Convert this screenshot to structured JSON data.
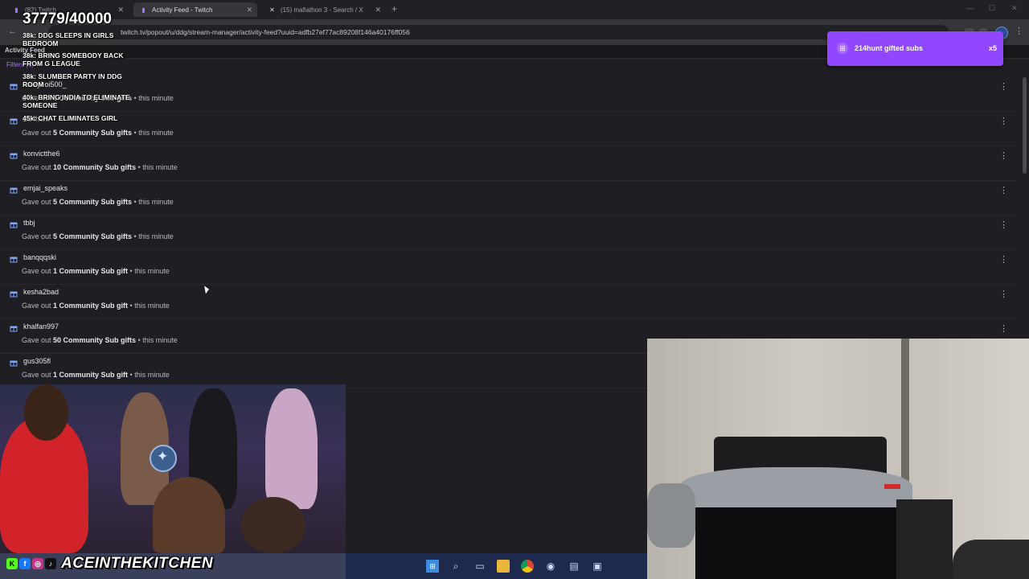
{
  "browser": {
    "tabs": [
      {
        "label": "(82) Twitch",
        "active": false
      },
      {
        "label": "Activity Feed - Twitch",
        "active": true
      },
      {
        "label": "(15) mafiathon 3 - Search / X",
        "active": false
      }
    ],
    "new_tab_label": "+",
    "url": "twitch.tv/popout/u/ddg/stream-manager/activity-feed?uuid=adfb27ef77ac89208f146a40176ff056"
  },
  "page": {
    "title": "Activity Feed",
    "filters_label": "Filters (1)"
  },
  "overlay": {
    "goal": "37779/40000",
    "milestones": [
      "38k: DDG SLEEPS IN GIRLS BEDROOM",
      "38k: BRING SOMEBODY BACK FROM G LEAGUE",
      "38k: SLUMBER PARTY IN DDG ROOM",
      "40k: BRING INDIA TO ELIMINATE SOMEONE",
      "45k: CHAT ELIMINATES GIRL"
    ]
  },
  "toast": {
    "text": "214hunt gifted subs",
    "multiplier": "x5",
    "color": "#9147ff"
  },
  "feed": {
    "items": [
      {
        "user": "krazyboi500_",
        "prefix": "Gave out ",
        "count": "5",
        "type": " Community Sub gifts",
        "time": " • this minute"
      },
      {
        "user": "214hunt",
        "prefix": "Gave out ",
        "count": "5",
        "type": " Community Sub gifts",
        "time": " • this minute"
      },
      {
        "user": "konvictthe6",
        "prefix": "Gave out ",
        "count": "10",
        "type": " Community Sub gifts",
        "time": " • this minute"
      },
      {
        "user": "emjai_speaks",
        "prefix": "Gave out ",
        "count": "5",
        "type": " Community Sub gifts",
        "time": " • this minute"
      },
      {
        "user": "tbbj",
        "prefix": "Gave out ",
        "count": "5",
        "type": " Community Sub gifts",
        "time": " • this minute"
      },
      {
        "user": "banqqqski",
        "prefix": "Gave out ",
        "count": "1",
        "type": " Community Sub gift",
        "time": " • this minute"
      },
      {
        "user": "kesha2bad",
        "prefix": "Gave out ",
        "count": "1",
        "type": " Community Sub gift",
        "time": " • this minute"
      },
      {
        "user": "khalfan997",
        "prefix": "Gave out ",
        "count": "50",
        "type": " Community Sub gifts",
        "time": " • this minute"
      },
      {
        "user": "gus305fl",
        "prefix": "Gave out ",
        "count": "1",
        "type": " Community Sub gift",
        "time": " • this minute"
      }
    ]
  },
  "stream": {
    "handle": "ACEINTHEKITCHEN",
    "socials": [
      "K",
      "f",
      "◎",
      "♪"
    ]
  },
  "theme": {
    "accent": "#a970ff",
    "background": "#1f1f23"
  }
}
